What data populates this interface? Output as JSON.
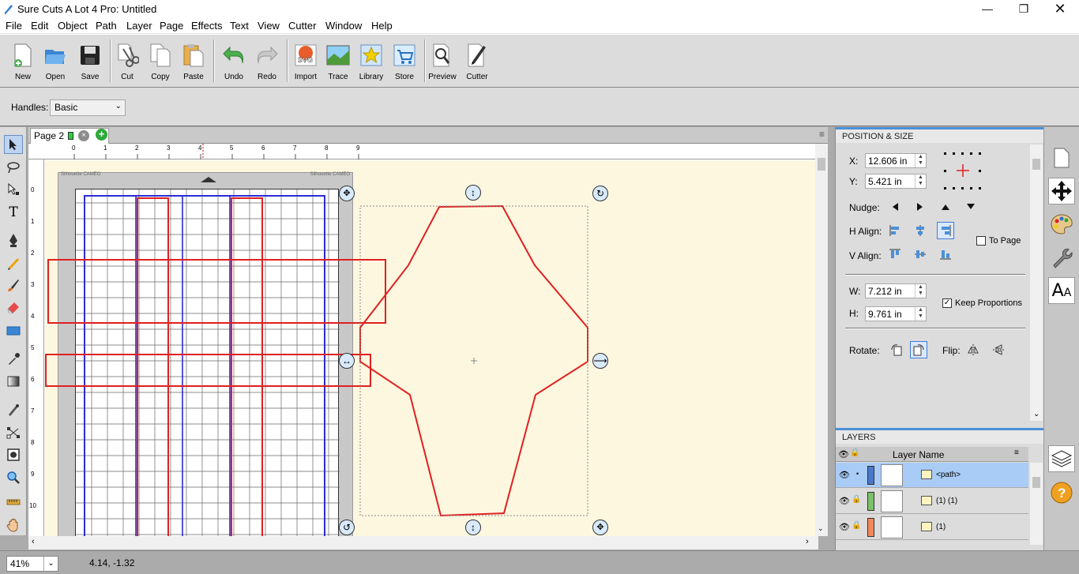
{
  "window": {
    "title": "Sure Cuts A Lot 4 Pro: Untitled",
    "controls": [
      "minimize-icon",
      "maximize-icon",
      "close-icon"
    ]
  },
  "menu": [
    "File",
    "Edit",
    "Object",
    "Path",
    "Layer",
    "Page",
    "Effects",
    "Text",
    "View",
    "Cutter",
    "Window",
    "Help"
  ],
  "toolbar": [
    {
      "label": "New",
      "icon": "new-document-icon"
    },
    {
      "label": "Open",
      "icon": "open-folder-icon"
    },
    {
      "label": "Save",
      "icon": "save-disk-icon"
    },
    {
      "label": "Cut",
      "icon": "scissors-icon"
    },
    {
      "label": "Copy",
      "icon": "copy-icon"
    },
    {
      "label": "Paste",
      "icon": "paste-icon"
    },
    {
      "label": "Undo",
      "icon": "undo-arrow-icon"
    },
    {
      "label": "Redo",
      "icon": "redo-arrow-icon"
    },
    {
      "label": "Import",
      "icon": "svg-import-icon"
    },
    {
      "label": "Trace",
      "icon": "trace-image-icon"
    },
    {
      "label": "Library",
      "icon": "star-library-icon"
    },
    {
      "label": "Store",
      "icon": "shopping-cart-icon"
    },
    {
      "label": "Preview",
      "icon": "magnifier-page-icon"
    },
    {
      "label": "Cutter",
      "icon": "cutter-pen-icon"
    }
  ],
  "options": {
    "handles_label": "Handles:",
    "handles_value": "Basic"
  },
  "page_tab": {
    "label": "Page 2"
  },
  "ruler": {
    "h_ticks": [
      "0",
      "1",
      "2",
      "3",
      "4",
      "5",
      "6",
      "7",
      "8",
      "9"
    ],
    "v_ticks": [
      "0",
      "1",
      "2",
      "3",
      "4",
      "5",
      "6",
      "7",
      "8",
      "9",
      "10"
    ]
  },
  "mat": {
    "left_brand": "Silhouette CAMEO",
    "right_brand": "Silhouette CAMEO"
  },
  "position_size": {
    "header": "POSITION & SIZE",
    "x_label": "X:",
    "x_value": "12.606 in",
    "y_label": "Y:",
    "y_value": "5.421 in",
    "nudge_label": "Nudge:",
    "halign_label": "H Align:",
    "valign_label": "V Align:",
    "to_page_label": "To Page",
    "to_page_checked": false,
    "w_label": "W:",
    "w_value": "7.212 in",
    "h_label": "H:",
    "h_value": "9.761 in",
    "keep_prop_label": "Keep Proportions",
    "keep_prop_checked": true,
    "rotate_label": "Rotate:",
    "flip_label": "Flip:"
  },
  "layers": {
    "header": "LAYERS",
    "column_label": "Layer Name",
    "rows": [
      {
        "name": "<path>",
        "color": "#4a78c8",
        "selected": true
      },
      {
        "name": "(1) (1)",
        "color": "#7cc06a",
        "selected": false
      },
      {
        "name": "(1)",
        "color": "#f08a5c",
        "selected": false
      }
    ]
  },
  "status": {
    "zoom": "41%",
    "coords": "4.14, -1.32"
  },
  "colors": {
    "accent": "#4a90d9",
    "cut_red": "#e02020",
    "mat_blue": "#2b2bd8",
    "work_bg": "#fdf7e0"
  }
}
